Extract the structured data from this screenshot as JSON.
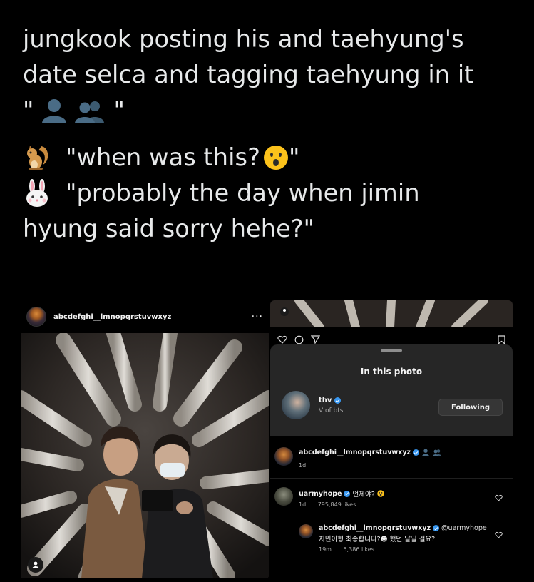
{
  "tweet": {
    "line1": "jungkook posting his and taehyung's",
    "line2": "date selca and tagging taehyung in it",
    "line3_open": "\"",
    "line3_close": "\"",
    "line3_icons": [
      "bust-in-silhouette-emoji",
      "busts-in-silhouette-emoji"
    ],
    "quote1": "\"when was this?",
    "quote1_end": " \"",
    "quote1_icon": "squirrel-emoji",
    "quote1_emoji": "hushed-face-emoji",
    "quote2_line1": "\"probably the day when jimin",
    "quote2_line2": "hyung said sorry hehe?\"",
    "quote2_icon": "rabbit-face-emoji"
  },
  "left_post": {
    "username": "abcdefghi__lmnopqrstuvwxyz",
    "more": "···",
    "photo_desc_icon": "tagged-person-icon"
  },
  "right_panel": {
    "sheet_title": "In this photo",
    "tagged_user": {
      "name": "thv",
      "subtitle": "V of bts",
      "follow_label": "Following"
    },
    "comments": [
      {
        "user": "abcdefghi__lmnopqrstuvwxyz",
        "time": "1d",
        "text": "",
        "icons": [
          "bust-in-silhouette-emoji",
          "busts-in-silhouette-emoji"
        ]
      },
      {
        "user": "uarmyhope",
        "text": "언제야?",
        "time": "1d",
        "likes": "795,849 likes",
        "emoji": "hushed-face-emoji"
      },
      {
        "user": "abcdefghi__lmnopqrstuvwxyz",
        "mention": "@uarmyhope",
        "text": "지민이형 최송합니다?☻ 했던 날일 걸요?",
        "time": "19m",
        "likes": "5,386 likes"
      }
    ]
  },
  "colors": {
    "background": "#000000",
    "text": "#e7e9ea",
    "sheet": "#262626",
    "verified": "#3897f0",
    "muted": "#a8a8a8"
  }
}
